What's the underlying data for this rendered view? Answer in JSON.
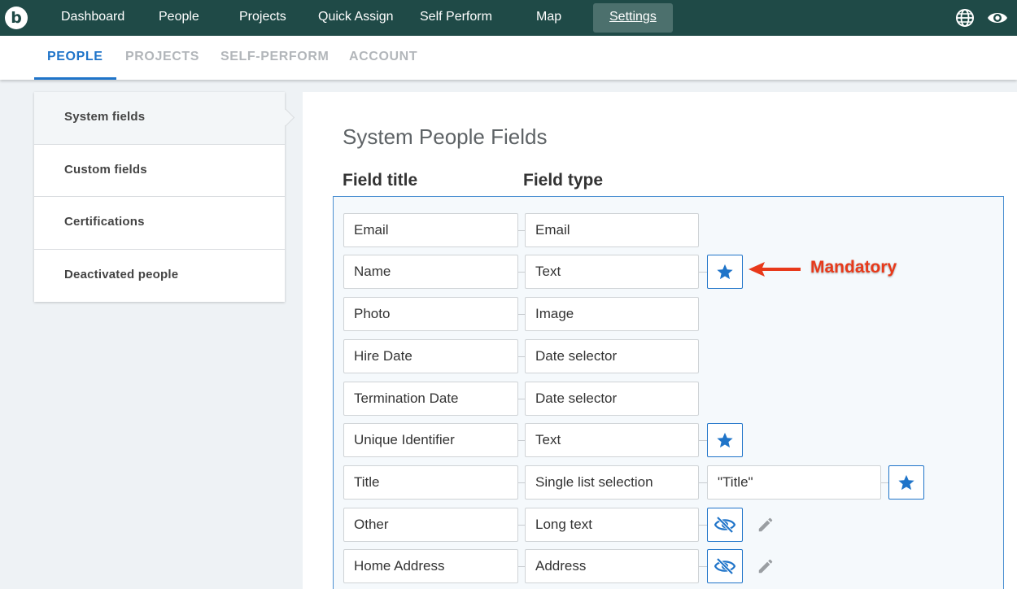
{
  "nav": {
    "logo": "b",
    "items": [
      "Dashboard",
      "People",
      "Projects",
      "Quick Assign",
      "Self Perform",
      "Map"
    ],
    "settings": "Settings",
    "icons": [
      "globe-icon",
      "eye-icon"
    ]
  },
  "tabs": {
    "people": "PEOPLE",
    "projects": "PROJECTS",
    "self_perform": "SELF-PERFORM",
    "account": "ACCOUNT"
  },
  "sidebar": {
    "items": [
      "System fields",
      "Custom fields",
      "Certifications",
      "Deactivated people"
    ]
  },
  "main": {
    "title": "System People Fields",
    "col_title": "Field title",
    "col_type": "Field type",
    "rows": [
      {
        "title": "Email",
        "type": "Email"
      },
      {
        "title": "Name",
        "type": "Text",
        "icon": "star-icon"
      },
      {
        "title": "Photo",
        "type": "Image"
      },
      {
        "title": "Hire Date",
        "type": "Date selector"
      },
      {
        "title": "Termination Date",
        "type": "Date selector"
      },
      {
        "title": "Unique Identifier",
        "type": "Text",
        "icon": "star-icon"
      },
      {
        "title": "Title",
        "type": "Single list selection",
        "extra": "\"Title\"",
        "icon": "star-icon"
      },
      {
        "title": "Other",
        "type": "Long text",
        "icon": "eye-slash-icon",
        "edit": "pencil-icon"
      },
      {
        "title": "Home Address",
        "type": "Address",
        "icon": "eye-slash-icon",
        "edit": "pencil-icon"
      }
    ]
  },
  "annotation": {
    "text": "Mandatory",
    "color": "#e8391a"
  },
  "colors": {
    "nav_bg": "#1f4a47",
    "accent": "#1f74c9"
  }
}
